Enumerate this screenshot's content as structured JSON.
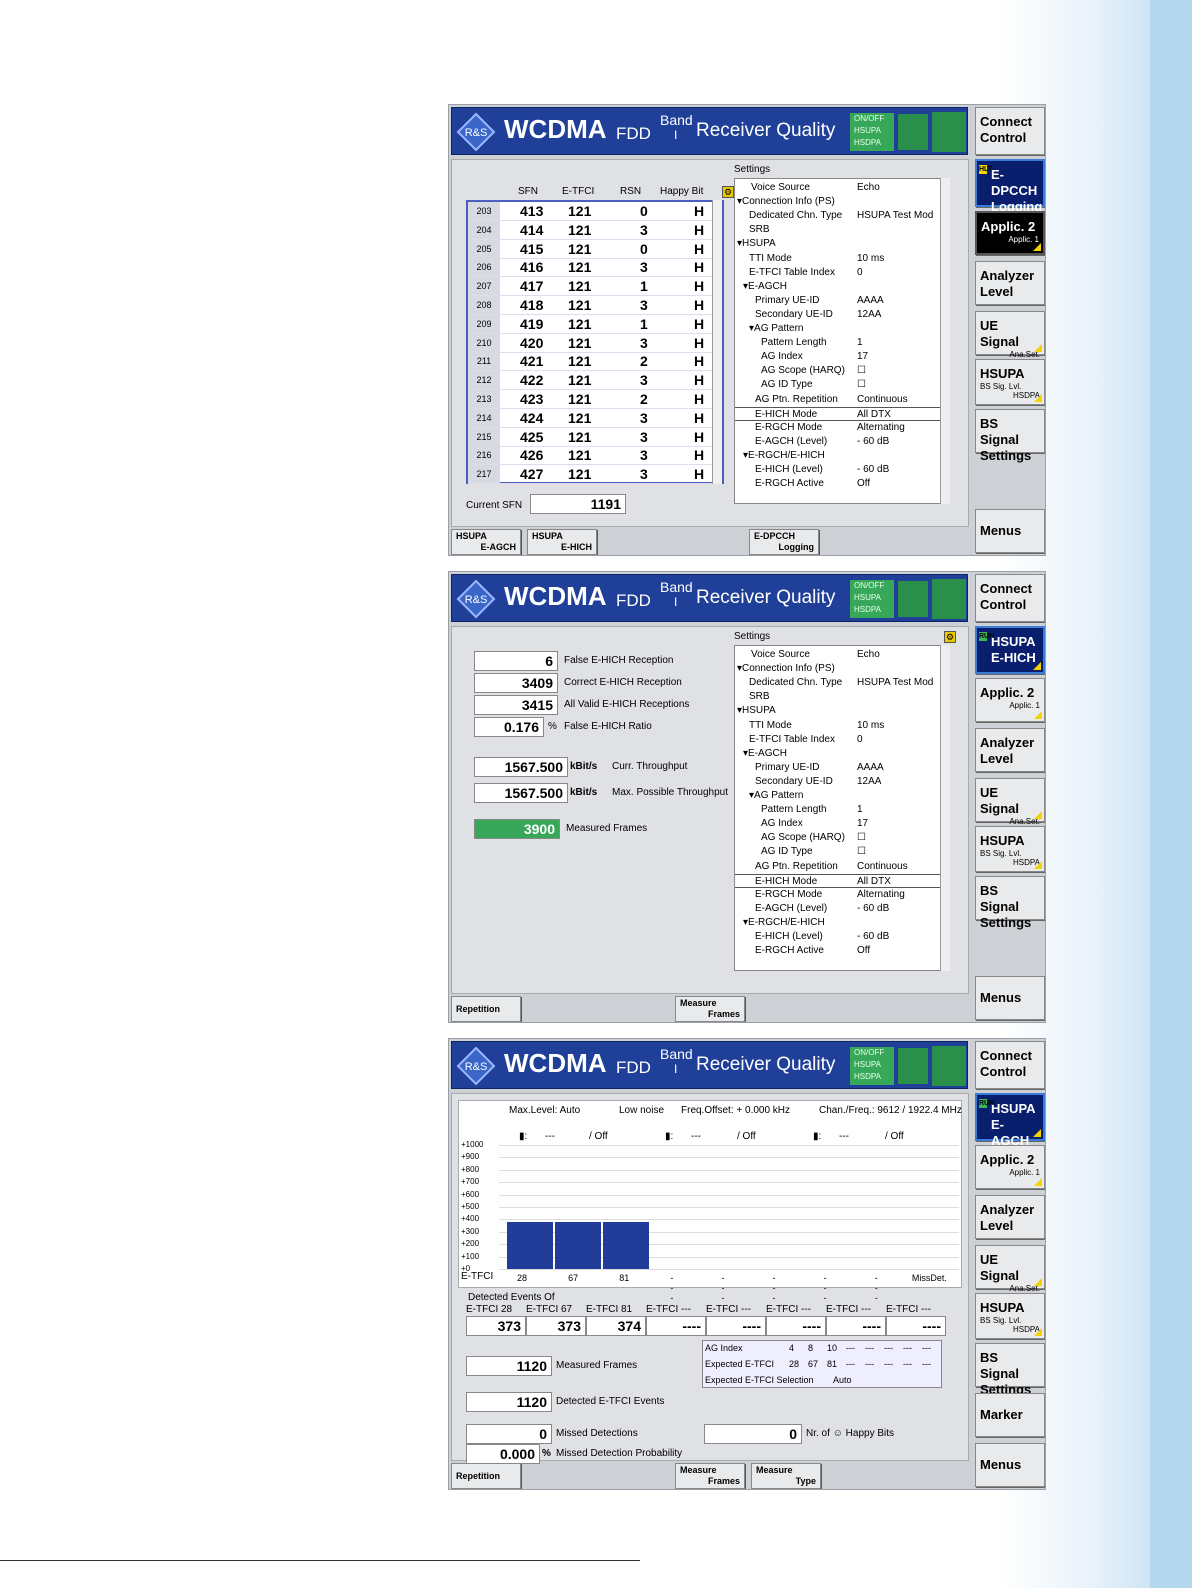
{
  "header": {
    "brand": "WCDMA",
    "sub": "FDD",
    "band_label": "Band",
    "band_num": "I",
    "mode": "Receiver Quality",
    "status": [
      "ON/OFF",
      "HSUPA",
      "HSDPA"
    ]
  },
  "softkeys_common": {
    "connect": "Connect Control",
    "applic": "Applic. 2",
    "applic_sub": "Applic. 1",
    "analyzer": "Analyzer Level",
    "ue_signal": "UE Signal",
    "ue_signal_sub": "Ana.Set.",
    "hsupa": "HSUPA",
    "hsupa_sub1": "BS Sig. Lvl.",
    "hsupa_sub2": "HSDPA",
    "bs_signal": "BS Signal Settings",
    "menus": "Menus",
    "marker": "Marker"
  },
  "screen1": {
    "active_softkey": "E-DPCCH Logging",
    "active_tag": "HLT",
    "table_headers": [
      "SFN",
      "E-TFCI",
      "RSN",
      "Happy Bit"
    ],
    "rows": [
      {
        "i": "203",
        "sfn": "413",
        "etfci": "121",
        "rsn": "0",
        "h": "H"
      },
      {
        "i": "204",
        "sfn": "414",
        "etfci": "121",
        "rsn": "3",
        "h": "H"
      },
      {
        "i": "205",
        "sfn": "415",
        "etfci": "121",
        "rsn": "0",
        "h": "H"
      },
      {
        "i": "206",
        "sfn": "416",
        "etfci": "121",
        "rsn": "3",
        "h": "H"
      },
      {
        "i": "207",
        "sfn": "417",
        "etfci": "121",
        "rsn": "1",
        "h": "H"
      },
      {
        "i": "208",
        "sfn": "418",
        "etfci": "121",
        "rsn": "3",
        "h": "H"
      },
      {
        "i": "209",
        "sfn": "419",
        "etfci": "121",
        "rsn": "1",
        "h": "H"
      },
      {
        "i": "210",
        "sfn": "420",
        "etfci": "121",
        "rsn": "3",
        "h": "H"
      },
      {
        "i": "211",
        "sfn": "421",
        "etfci": "121",
        "rsn": "2",
        "h": "H"
      },
      {
        "i": "212",
        "sfn": "422",
        "etfci": "121",
        "rsn": "3",
        "h": "H"
      },
      {
        "i": "213",
        "sfn": "423",
        "etfci": "121",
        "rsn": "2",
        "h": "H"
      },
      {
        "i": "214",
        "sfn": "424",
        "etfci": "121",
        "rsn": "3",
        "h": "H"
      },
      {
        "i": "215",
        "sfn": "425",
        "etfci": "121",
        "rsn": "3",
        "h": "H"
      },
      {
        "i": "216",
        "sfn": "426",
        "etfci": "121",
        "rsn": "3",
        "h": "H"
      },
      {
        "i": "217",
        "sfn": "427",
        "etfci": "121",
        "rsn": "3",
        "h": "H"
      }
    ],
    "current_sfn_label": "Current SFN",
    "current_sfn": "1191",
    "bottom_buttons": [
      [
        "HSUPA",
        "E-AGCH"
      ],
      [
        "HSUPA",
        "E-HICH"
      ],
      [
        "E-DPCCH",
        "Logging"
      ]
    ]
  },
  "settings": {
    "title": "Settings",
    "rows": [
      {
        "k": "Voice Source",
        "v": "Echo"
      },
      {
        "k": "▾Connection Info (PS)",
        "v": ""
      },
      {
        "k": "Dedicated Chn. Type",
        "v": "HSUPA Test Mod"
      },
      {
        "k": "SRB",
        "v": ""
      },
      {
        "k": "▾HSUPA",
        "v": ""
      },
      {
        "k": "TTI Mode",
        "v": "10 ms"
      },
      {
        "k": "E-TFCI Table Index",
        "v": "0"
      },
      {
        "k": "▾E-AGCH",
        "v": ""
      },
      {
        "k": "Primary UE-ID",
        "v": "AAAA"
      },
      {
        "k": "Secondary UE-ID",
        "v": "12AA"
      },
      {
        "k": "▾AG Pattern",
        "v": ""
      },
      {
        "k": "Pattern Length",
        "v": "1"
      },
      {
        "k": "AG Index",
        "v": "17"
      },
      {
        "k": "AG Scope (HARQ)",
        "v": "☐"
      },
      {
        "k": "AG ID Type",
        "v": "☐"
      },
      {
        "k": "AG Ptn. Repetition",
        "v": "Continuous"
      },
      {
        "k": "E-HICH Mode",
        "v": "All DTX"
      },
      {
        "k": "E-RGCH Mode",
        "v": "Alternating"
      },
      {
        "k": "E-AGCH (Level)",
        "v": "- 60 dB"
      },
      {
        "k": "▾E-RGCH/E-HICH",
        "v": ""
      },
      {
        "k": "E-HICH (Level)",
        "v": "- 60 dB"
      },
      {
        "k": "E-RGCH Active",
        "v": "Off"
      }
    ]
  },
  "screen2": {
    "active_softkey": "HSUPA E-HICH",
    "active_tag": "RUN",
    "values": [
      {
        "v": "6",
        "l": "False E-HICH Reception"
      },
      {
        "v": "3409",
        "l": "Correct E-HICH Reception"
      },
      {
        "v": "3415",
        "l": "All Valid E-HICH Receptions"
      },
      {
        "v": "0.176",
        "u": "%",
        "l": "False E-HICH Ratio"
      }
    ],
    "throughput": [
      {
        "v": "1567.500",
        "u": "kBit/s",
        "l": "Curr. Throughput"
      },
      {
        "v": "1567.500",
        "u": "kBit/s",
        "l": "Max. Possible Throughput"
      }
    ],
    "measured": {
      "v": "3900",
      "l": "Measured Frames"
    },
    "bottom_buttons": [
      [
        "Repetition",
        ""
      ],
      [
        "Measure",
        "Frames"
      ]
    ]
  },
  "screen3": {
    "active_softkey": "HSUPA E-AGCH",
    "active_tag": "RUN",
    "info": {
      "maxlevel": "Max.Level: Auto",
      "noise": "Low noise",
      "freq": "Freq.Offset: + 0.000 kHz",
      "chan": "Chan./Freq.: 9612 / 1922.4 MHz"
    },
    "markers": [
      {
        "v": "---",
        "s": "/ Off"
      },
      {
        "v": "---",
        "s": "/ Off"
      },
      {
        "v": "---",
        "s": "/ Off"
      }
    ],
    "chart_data": {
      "type": "bar",
      "categories": [
        "28",
        "67",
        "81",
        "---",
        "---",
        "---",
        "---",
        "---",
        "MissDet."
      ],
      "values": [
        380,
        380,
        380,
        0,
        0,
        0,
        0,
        0,
        0
      ],
      "ylim": [
        0,
        1000
      ],
      "yticks": [
        "+0",
        "+100",
        "+200",
        "+300",
        "+400",
        "+500",
        "+600",
        "+700",
        "+800",
        "+900",
        "+1000"
      ],
      "xlabel": "E-TFCI"
    },
    "detected_title": "Detected Events Of",
    "detected": [
      {
        "h": "E-TFCI 28",
        "v": "373"
      },
      {
        "h": "E-TFCI 67",
        "v": "373"
      },
      {
        "h": "E-TFCI 81",
        "v": "374"
      },
      {
        "h": "E-TFCI ---",
        "v": "----"
      },
      {
        "h": "E-TFCI ---",
        "v": "----"
      },
      {
        "h": "E-TFCI ---",
        "v": "----"
      },
      {
        "h": "E-TFCI ---",
        "v": "----"
      },
      {
        "h": "E-TFCI ---",
        "v": "----"
      }
    ],
    "measured": {
      "v": "1120",
      "l": "Measured Frames"
    },
    "detected_events": {
      "v": "1120",
      "l": "Detected E-TFCI Events"
    },
    "missed": {
      "v": "0",
      "l": "Missed Detections"
    },
    "missed_prob": {
      "v": "0.000",
      "u": "%",
      "l": "Missed Detection Probability"
    },
    "happy": {
      "v": "0",
      "l": "Nr. of ☺ Happy Bits"
    },
    "ag_table": {
      "r1": [
        "AG Index",
        "4",
        "8",
        "10",
        "---",
        "---",
        "---",
        "---",
        "---"
      ],
      "r2": [
        "Expected E-TFCI",
        "28",
        "67",
        "81",
        "---",
        "---",
        "---",
        "---",
        "---"
      ],
      "r3": [
        "Expected E-TFCI Selection",
        "Auto"
      ]
    },
    "bottom_buttons": [
      [
        "Repetition",
        ""
      ],
      [
        "Measure",
        "Frames"
      ],
      [
        "Measure",
        "Type"
      ]
    ]
  },
  "colors": {
    "title": "#1f3f99",
    "bar": "#223c9a",
    "green": "#37a85a",
    "active": "#0a1e6e"
  }
}
